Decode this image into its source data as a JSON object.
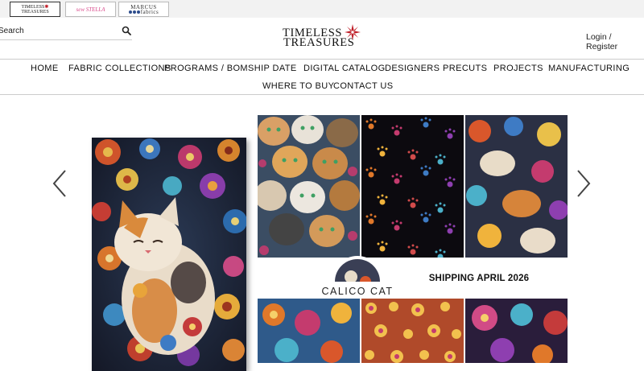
{
  "brands": [
    {
      "name": "Timeless Treasures"
    },
    {
      "name": "Sew Stella"
    },
    {
      "name": "Marcus Fabrics"
    }
  ],
  "search": {
    "placeholder": "Search"
  },
  "logo": {
    "line1": "TIMELESS",
    "line2": "TREASURES"
  },
  "account": {
    "login": "Login",
    "separator": " / ",
    "register": "Register"
  },
  "nav": {
    "row1": [
      "HOME",
      "FABRIC COLLECTIONS",
      "PROGRAMS / BOM",
      "SHIP DATE",
      "DIGITAL CATALOG",
      "DESIGNERS",
      "PRECUTS",
      "PROJECTS",
      "MANUFACTURING"
    ],
    "row2": [
      "WHERE TO BUY",
      "CONTACT US"
    ]
  },
  "hero": {
    "collection": "CALICO CAT",
    "shipping": "SHIPPING APRIL 2026"
  },
  "colors": {
    "accent_red": "#c0202a",
    "sew_stella_pink": "#d94b8c",
    "text": "#111111"
  },
  "icons": {
    "search": "search-icon",
    "prev": "chevron-left-icon",
    "next": "chevron-right-icon"
  }
}
